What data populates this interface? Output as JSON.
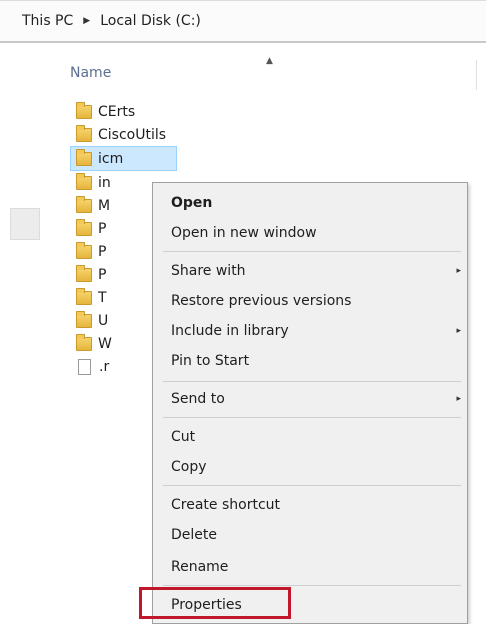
{
  "breadcrumb": {
    "items": [
      "This PC",
      "Local Disk (C:)"
    ]
  },
  "columns": {
    "name_header": "Name"
  },
  "files": [
    {
      "name": "CErts",
      "type": "folder"
    },
    {
      "name": "CiscoUtils",
      "type": "folder"
    },
    {
      "name": "icm",
      "type": "folder",
      "selected": true
    },
    {
      "name": "in",
      "type": "folder"
    },
    {
      "name": "M",
      "type": "folder"
    },
    {
      "name": "P",
      "type": "folder"
    },
    {
      "name": "P",
      "type": "folder"
    },
    {
      "name": "P",
      "type": "folder"
    },
    {
      "name": "T",
      "type": "folder"
    },
    {
      "name": "U",
      "type": "folder"
    },
    {
      "name": "W",
      "type": "folder"
    },
    {
      "name": ".r",
      "type": "file"
    }
  ],
  "context_menu": {
    "open": "Open",
    "open_new_window": "Open in new window",
    "share_with": "Share with",
    "restore_previous": "Restore previous versions",
    "include_in_library": "Include in library",
    "pin_to_start": "Pin to Start",
    "send_to": "Send to",
    "cut": "Cut",
    "copy": "Copy",
    "create_shortcut": "Create shortcut",
    "delete": "Delete",
    "rename": "Rename",
    "properties": "Properties",
    "submenu_arrow": "▸"
  },
  "colors": {
    "selection_bg": "#cce8ff",
    "highlight_border": "#c0182a"
  }
}
